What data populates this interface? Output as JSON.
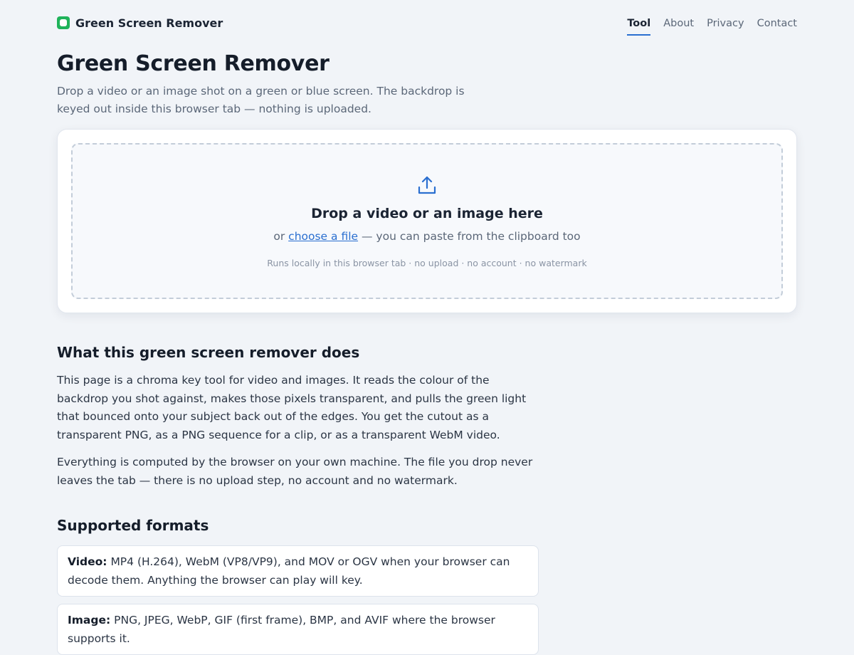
{
  "header": {
    "brand": "Green Screen Remover",
    "brand_color": "#1fb35a",
    "nav": [
      {
        "label": "Tool",
        "active": true
      },
      {
        "label": "About",
        "active": false
      },
      {
        "label": "Privacy",
        "active": false
      },
      {
        "label": "Contact",
        "active": false
      }
    ]
  },
  "hero": {
    "title": "Green Screen Remover",
    "intro": "Drop a video or an image shot on a green or blue screen. The backdrop is keyed out inside this browser tab — nothing is uploaded."
  },
  "dropzone": {
    "icon": "upload-icon",
    "title": "Drop a video or an image here",
    "sub_prefix": "or",
    "sub_link": "choose a file",
    "sub_suffix": "— you can paste from the clipboard too",
    "note": "Runs locally in this browser tab · no upload · no account · no watermark"
  },
  "about": {
    "heading": "What this green screen remover does",
    "p1": "This page is a chroma key tool for video and images. It reads the colour of the backdrop you shot against, makes those pixels transparent, and pulls the green light that bounced onto your subject back out of the edges. You get the cutout as a transparent PNG, as a PNG sequence for a clip, or as a transparent WebM video.",
    "p2": "Everything is computed by the browser on your own machine. The file you drop never leaves the tab — there is no upload step, no account and no watermark."
  },
  "formats": {
    "heading": "Supported formats",
    "items": [
      {
        "label": "Video:",
        "text": "MP4 (H.264), WebM (VP8/VP9), and MOV or OGV when your browser can decode them. Anything the browser can play will key."
      },
      {
        "label": "Image:",
        "text": "PNG, JPEG, WebP, GIF (first frame), BMP, and AVIF where the browser supports it."
      }
    ]
  },
  "colors": {
    "accent": "#2a6fd0",
    "background": "#f1f4f8"
  }
}
